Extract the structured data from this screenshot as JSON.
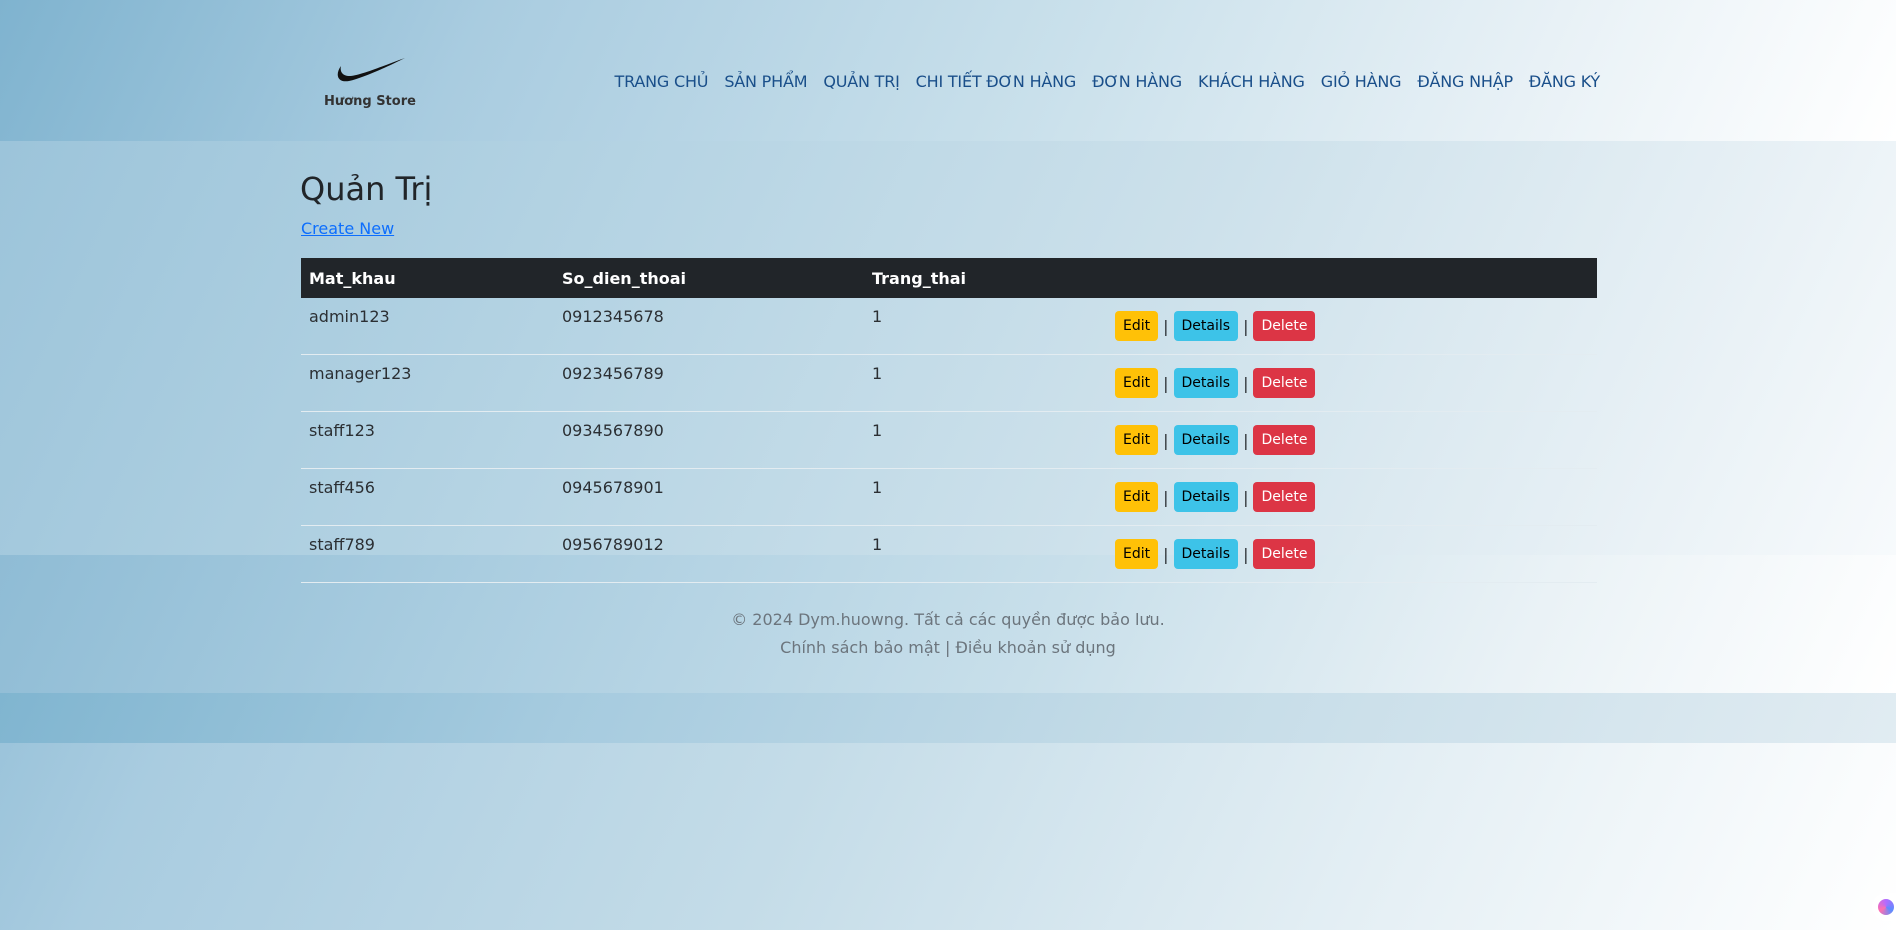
{
  "brand": {
    "name": "Hương Store",
    "logo_icon": "swoosh-logo-icon"
  },
  "nav": {
    "items": [
      {
        "label": "TRANG CHỦ"
      },
      {
        "label": "SẢN PHẨM"
      },
      {
        "label": "QUẢN TRỊ"
      },
      {
        "label": "CHI TIẾT ĐƠN HÀNG"
      },
      {
        "label": "ĐƠN HÀNG"
      },
      {
        "label": "KHÁCH HÀNG"
      },
      {
        "label": "GIỎ HÀNG"
      },
      {
        "label": "ĐĂNG NHẬP"
      },
      {
        "label": "ĐĂNG KÝ"
      }
    ]
  },
  "page": {
    "title": "Quản Trị",
    "create_link": "Create New"
  },
  "table": {
    "headers": [
      "Mat_khau",
      "So_dien_thoai",
      "Trang_thai",
      ""
    ],
    "rows": [
      {
        "mat_khau": "admin123",
        "so_dien_thoai": "0912345678",
        "trang_thai": "1"
      },
      {
        "mat_khau": "manager123",
        "so_dien_thoai": "0923456789",
        "trang_thai": "1"
      },
      {
        "mat_khau": "staff123",
        "so_dien_thoai": "0934567890",
        "trang_thai": "1"
      },
      {
        "mat_khau": "staff456",
        "so_dien_thoai": "0945678901",
        "trang_thai": "1"
      },
      {
        "mat_khau": "staff789",
        "so_dien_thoai": "0956789012",
        "trang_thai": "1"
      }
    ],
    "actions": {
      "edit": "Edit",
      "details": "Details",
      "delete": "Delete",
      "separator": "|"
    }
  },
  "footer": {
    "copyright": "© 2024 Dym.huowng. Tất cả các quyền được bảo lưu.",
    "privacy": "Chính sách bảo mật",
    "separator": "|",
    "terms": "Điều khoản sử dụng"
  },
  "colors": {
    "nav_text": "#1a4f8a",
    "table_header_bg": "#212529",
    "edit_button": "#ffc107",
    "details_button": "#3dc3e8",
    "delete_button": "#dc3545",
    "link": "#0d6efd"
  }
}
